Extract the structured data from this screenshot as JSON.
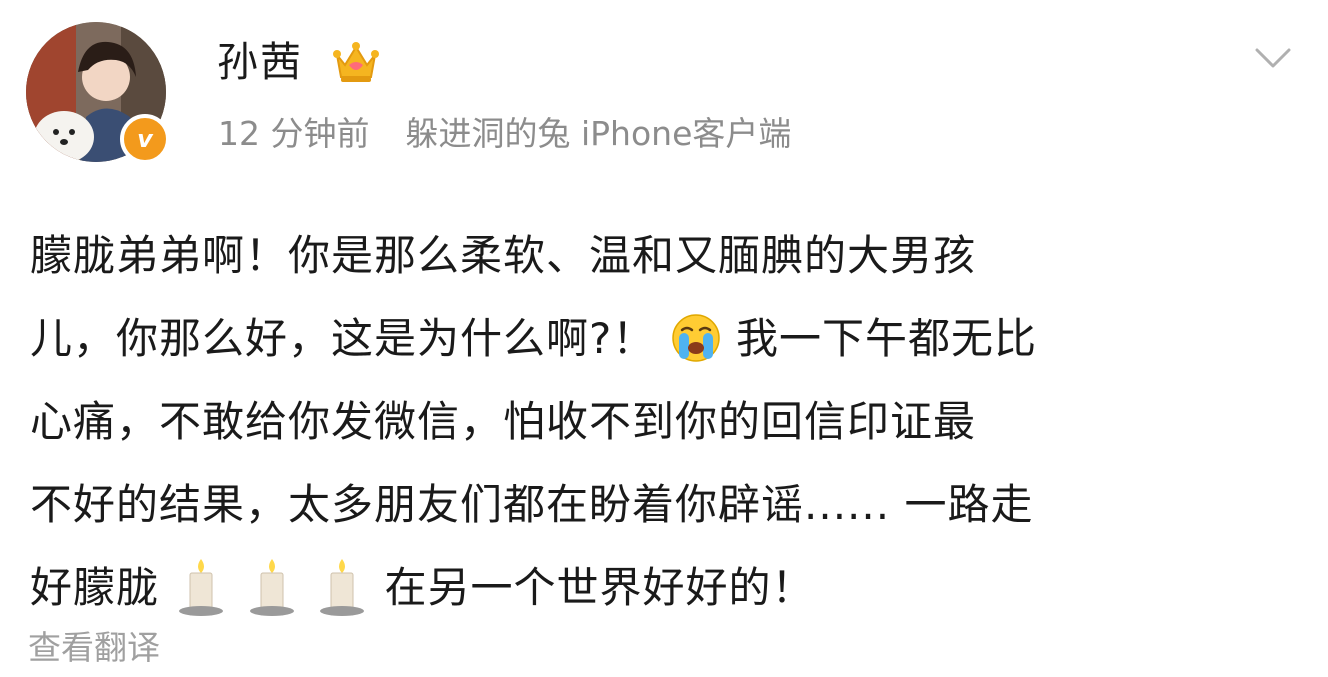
{
  "post": {
    "username": "孙茜",
    "time": "12 分钟前",
    "source": "躲进洞的兔 iPhone客户端",
    "verified_badge": "v",
    "lines": [
      {
        "text": "朦胧弟弟啊！你是那么柔软、温和又腼腆的大男孩"
      },
      {
        "before": "儿，你那么好，这是为什么啊?！",
        "after": "我一下午都无比"
      },
      {
        "text": "心痛，不敢给你发微信，怕收不到你的回信印证最"
      },
      {
        "text": "不好的结果，太多朋友们都在盼着你辟谣...... 一路走"
      },
      {
        "before": "好朦胧",
        "after": "在另一个世界好好的！"
      }
    ],
    "translate_label": "查看翻译"
  },
  "icons": {
    "avatar": "user-avatar-photo",
    "crown": "crown-icon",
    "chevron": "chevron-down-icon",
    "crying": "crying-face-emoji",
    "candle": "candle-emoji"
  },
  "colors": {
    "text": "#1a1a1a",
    "meta": "#8c8c8c",
    "badge": "#f39a1c",
    "crown": "#f5b520"
  }
}
